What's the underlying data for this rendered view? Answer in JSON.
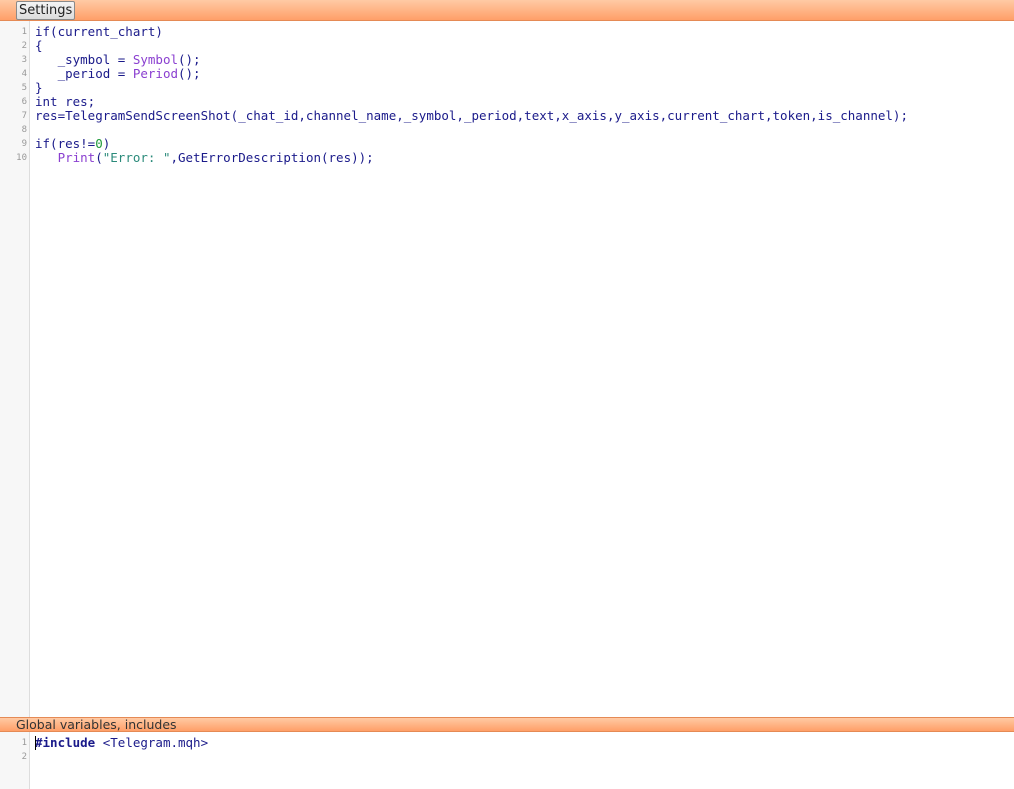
{
  "toolbar": {
    "settings_label": "Settings"
  },
  "main_editor": {
    "lines": [
      {
        "n": "1",
        "parts": [
          {
            "t": "if(current_chart)",
            "c": "plain"
          }
        ]
      },
      {
        "n": "2",
        "parts": [
          {
            "t": "{",
            "c": "plain"
          }
        ]
      },
      {
        "n": "3",
        "parts": [
          {
            "t": "   _symbol = ",
            "c": "plain"
          },
          {
            "t": "Symbol",
            "c": "fn"
          },
          {
            "t": "();",
            "c": "plain"
          }
        ]
      },
      {
        "n": "4",
        "parts": [
          {
            "t": "   _period = ",
            "c": "plain"
          },
          {
            "t": "Period",
            "c": "fn"
          },
          {
            "t": "();",
            "c": "plain"
          }
        ]
      },
      {
        "n": "5",
        "parts": [
          {
            "t": "}",
            "c": "plain"
          }
        ]
      },
      {
        "n": "6",
        "parts": [
          {
            "t": "int res;",
            "c": "plain"
          }
        ]
      },
      {
        "n": "7",
        "parts": [
          {
            "t": "res=TelegramSendScreenShot(_chat_id,channel_name,_symbol,_period,text,x_axis,y_axis,current_chart,token,is_channel);",
            "c": "plain"
          }
        ]
      },
      {
        "n": "8",
        "parts": []
      },
      {
        "n": "9",
        "parts": [
          {
            "t": "if(res!=",
            "c": "plain"
          },
          {
            "t": "0",
            "c": "num"
          },
          {
            "t": ")",
            "c": "plain"
          }
        ]
      },
      {
        "n": "10",
        "parts": [
          {
            "t": "   ",
            "c": "plain"
          },
          {
            "t": "Print",
            "c": "fn"
          },
          {
            "t": "(",
            "c": "plain"
          },
          {
            "t": "\"Error: \"",
            "c": "str"
          },
          {
            "t": ",GetErrorDescription(res));",
            "c": "plain"
          }
        ]
      }
    ]
  },
  "globals_section": {
    "title": "Global variables, includes",
    "lines": [
      {
        "n": "1",
        "parts": [
          {
            "t": "#include",
            "c": "pre"
          },
          {
            "t": " <Telegram.mqh>",
            "c": "inc"
          }
        ]
      },
      {
        "n": "2",
        "parts": []
      }
    ]
  },
  "colors": {
    "bar_top": "#ffcaa4",
    "bar_bottom": "#ff9f68",
    "function": "#8a3fd0",
    "string": "#2a8a7a",
    "number": "#1f9a3a",
    "code": "#1a1a8a"
  }
}
